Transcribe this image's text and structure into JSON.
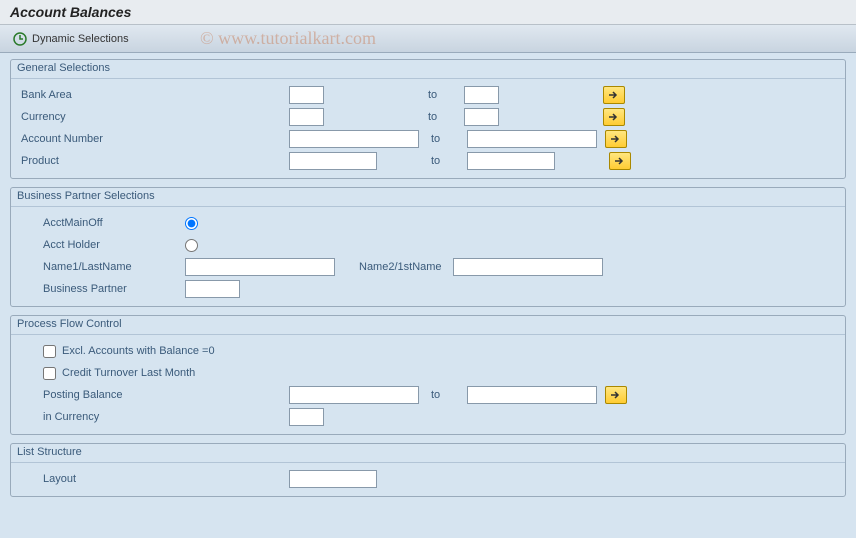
{
  "title": "Account Balances",
  "toolbar": {
    "dynamic_selections": "Dynamic Selections"
  },
  "watermark": "© www.tutorialkart.com",
  "group1": {
    "title": "General Selections",
    "bank_area": "Bank Area",
    "currency": "Currency",
    "account_number": "Account Number",
    "product": "Product",
    "to": "to"
  },
  "group2": {
    "title": "Business Partner Selections",
    "acct_main_off": "AcctMainOff",
    "acct_holder": "Acct Holder",
    "name1": "Name1/LastName",
    "name2": "Name2/1stName",
    "business_partner": "Business Partner"
  },
  "group3": {
    "title": "Process Flow Control",
    "excl_zero": "Excl. Accounts with Balance =0",
    "credit_turnover": "Credit Turnover Last Month",
    "posting_balance": "Posting Balance",
    "in_currency": "in Currency",
    "to": "to"
  },
  "group4": {
    "title": "List Structure",
    "layout": "Layout"
  }
}
